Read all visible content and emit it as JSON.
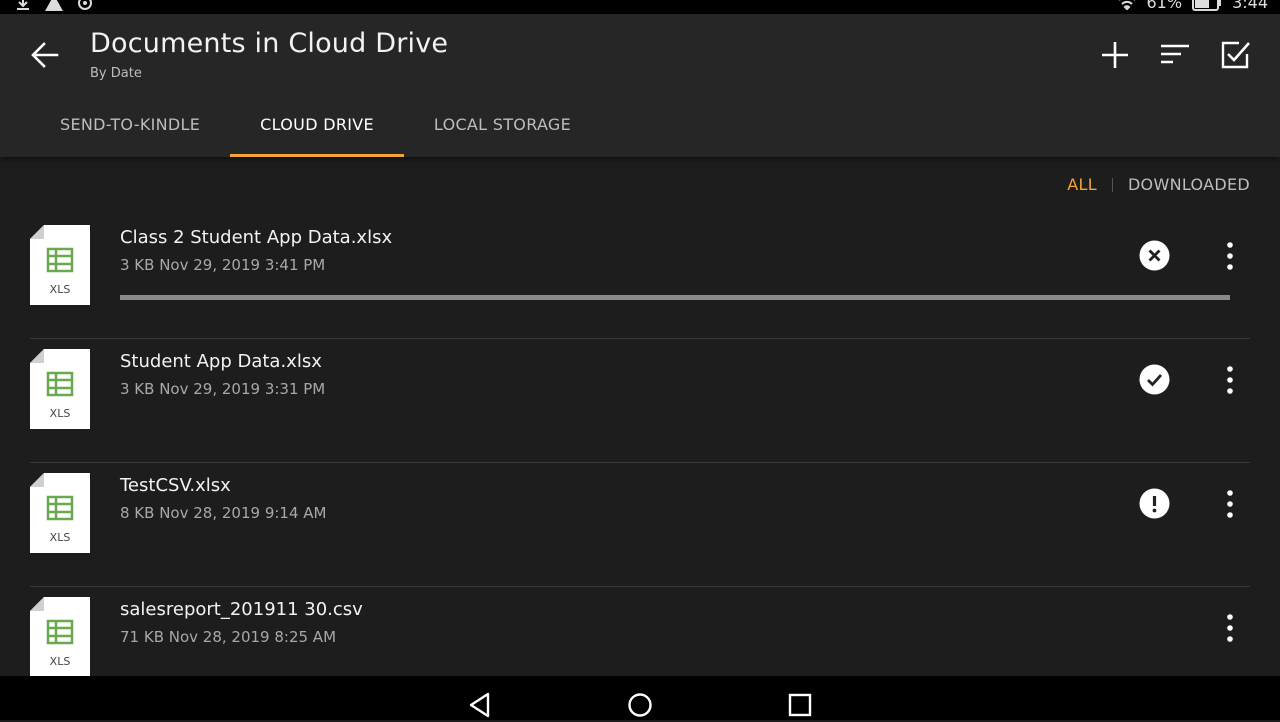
{
  "statusbar": {
    "battery": "61%",
    "time": "3:44"
  },
  "header": {
    "title": "Documents in Cloud Drive",
    "subtitle": "By Date"
  },
  "tabs": [
    {
      "label": "SEND-TO-KINDLE",
      "active": false
    },
    {
      "label": "CLOUD DRIVE",
      "active": true
    },
    {
      "label": "LOCAL STORAGE",
      "active": false
    }
  ],
  "filters": {
    "all": "ALL",
    "downloaded": "DOWNLOADED"
  },
  "files": [
    {
      "name": "Class 2 Student App Data.xlsx",
      "meta": "3 KB Nov 29, 2019 3:41 PM",
      "type_label": "XLS",
      "status": "cancel",
      "progress": 1.0
    },
    {
      "name": "Student App Data.xlsx",
      "meta": "3 KB Nov 29, 2019 3:31 PM",
      "type_label": "XLS",
      "status": "done"
    },
    {
      "name": "TestCSV.xlsx",
      "meta": "8 KB Nov 28, 2019 9:14 AM",
      "type_label": "XLS",
      "status": "error"
    },
    {
      "name": "salesreport_201911 30.csv",
      "meta": "71 KB Nov 28, 2019 8:25 AM",
      "type_label": "XLS",
      "status": "none"
    }
  ],
  "colors": {
    "accent": "#f2a33a",
    "spreadsheet_green": "#6aa84f",
    "background": "#1d1d1d",
    "appbar": "#262626"
  },
  "icons": {
    "back": "arrow-left-icon",
    "add": "plus-icon",
    "sort": "sort-icon",
    "select": "checkbox-icon",
    "more": "more-vertical-icon"
  }
}
